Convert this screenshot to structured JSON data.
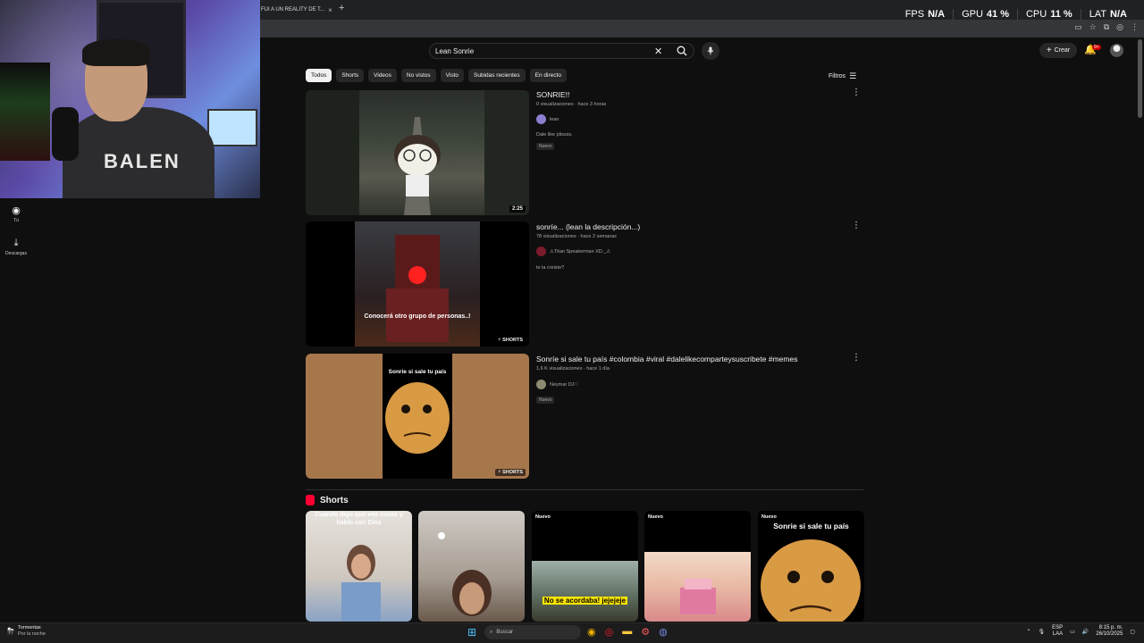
{
  "browser": {
    "tab_title": "FUI A UN REALITY DE T...",
    "tab_close": "×",
    "new_tab": "+",
    "stats": [
      {
        "label": "FPS",
        "value": "N/A"
      },
      {
        "label": "GPU",
        "value": "41 %"
      },
      {
        "label": "CPU",
        "value": "11 %"
      },
      {
        "label": "LAT",
        "value": "N/A"
      }
    ]
  },
  "nav": {
    "you_label": "Tú",
    "downloads_label": "Descargas"
  },
  "search": {
    "query": "Lean Sonrie"
  },
  "header": {
    "create_label": "Crear",
    "notif_count": "9+"
  },
  "chips": [
    "Todos",
    "Shorts",
    "Videos",
    "No vistos",
    "Visto",
    "Subidas recientes",
    "En directo"
  ],
  "filters_label": "Filtros",
  "results": [
    {
      "title": "SONRIE!!",
      "meta": "0 visualizaciones · hace 3 horas",
      "channel": "lean",
      "desc": "Dale like plissss.",
      "badge": "Nuevo",
      "duration": "2:25"
    },
    {
      "title": "sonríe... (lean la descripción...)",
      "meta": "78 visualizaciones · hace 2 semanas",
      "channel": "⚠Titan Speakerman XD._⚠",
      "desc": "te la creiste?",
      "overlay": "Conocerá otro grupo de personas..!",
      "shorts_label": "SHORTS"
    },
    {
      "title": "Sonríe si sale tu país #colombia #viral #dalelikecomparteysuscribete #memes",
      "meta": "1,6 K visualizaciones · hace 1 día",
      "channel": "Neymar DJ♡",
      "badge": "Nuevo",
      "overlay": "Sonrie si sale tu país",
      "shorts_label": "SHORTS"
    }
  ],
  "shorts_section": {
    "title": "Shorts",
    "cards": [
      {
        "new": "",
        "caption": "Cuando digo que veo cosas y hablo con Dios"
      },
      {
        "new": "",
        "caption": ""
      },
      {
        "new": "Nuevo",
        "caption": "No se acordaba! jejejeje"
      },
      {
        "new": "Nuevo",
        "caption": ""
      },
      {
        "new": "Nuevo",
        "caption": "Sonrie si sale tu país"
      }
    ]
  },
  "taskbar": {
    "weather_title": "Tormentas",
    "weather_sub": "Por la noche",
    "search_placeholder": "Buscar",
    "lang": "ESP",
    "lang_sub": "LAA",
    "time": "8:15 p. m.",
    "date": "26/10/2025"
  }
}
